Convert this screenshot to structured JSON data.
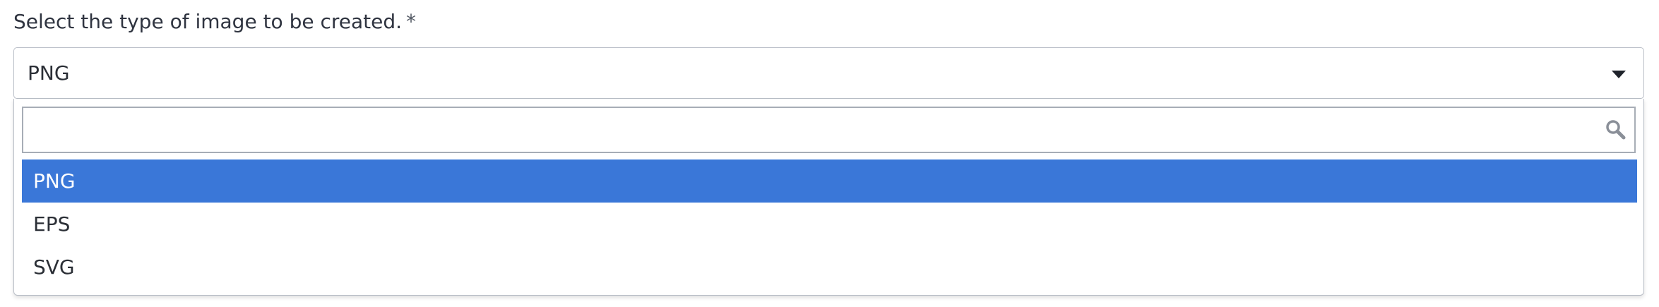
{
  "field": {
    "label": "Select the type of image to be created.",
    "required_marker": "*"
  },
  "select": {
    "value": "PNG",
    "arrow_icon": "caret-down-icon"
  },
  "search": {
    "value": "",
    "placeholder": "",
    "icon": "search-icon"
  },
  "options": [
    {
      "label": "PNG",
      "selected": true
    },
    {
      "label": "EPS",
      "selected": false
    },
    {
      "label": "SVG",
      "selected": false
    }
  ],
  "colors": {
    "highlight": "#3a77d8",
    "highlight_text": "#ffffff",
    "text": "#2b2f36",
    "border": "#b9bec7"
  }
}
